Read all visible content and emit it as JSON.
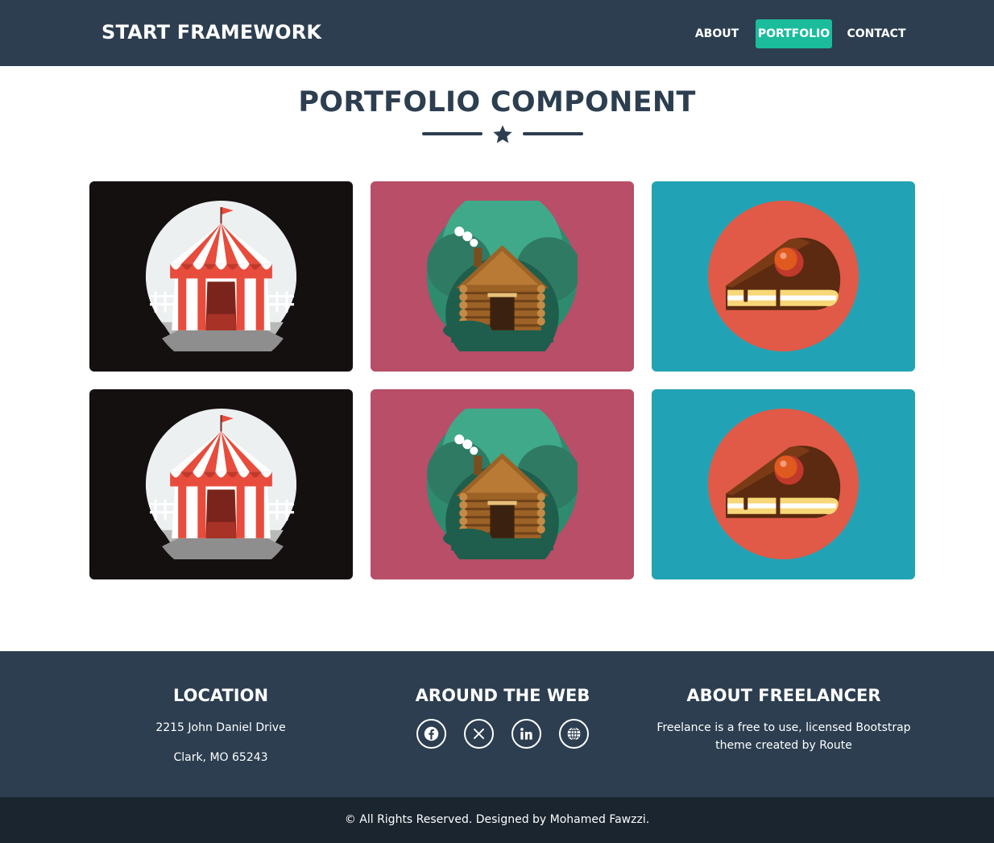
{
  "navbar": {
    "brand": "START FRAMEWORK",
    "links": [
      {
        "label": "ABOUT"
      },
      {
        "label": "PORTFOLIO"
      },
      {
        "label": "CONTACT"
      }
    ]
  },
  "header": {
    "title": "PORTFOLIO COMPONENT"
  },
  "portfolio": {
    "items": [
      {
        "image": "circus-tent",
        "bg": "#151010"
      },
      {
        "image": "log-cabin",
        "bg": "#b84e68"
      },
      {
        "image": "cake-slice",
        "bg": "#22a3b5"
      },
      {
        "image": "circus-tent",
        "bg": "#151010"
      },
      {
        "image": "log-cabin",
        "bg": "#b84e68"
      },
      {
        "image": "cake-slice",
        "bg": "#22a3b5"
      }
    ]
  },
  "footer": {
    "location": {
      "heading": "LOCATION",
      "line1": "2215 John Daniel Drive",
      "line2": "Clark, MO 65243"
    },
    "web": {
      "heading": "AROUND THE WEB",
      "icons": [
        "facebook-icon",
        "x-icon",
        "linkedin-icon",
        "globe-icon"
      ]
    },
    "about": {
      "heading": "ABOUT FREELANCER",
      "line1": "Freelance is a free to use, licensed Bootstrap",
      "line2": "theme created by Route"
    },
    "copyright": "© All Rights Reserved. Designed by Mohamed Fawzzi."
  },
  "colors": {
    "primary": "#2c3e50",
    "accent": "#1abc9c",
    "dark_footer": "#1a252f"
  }
}
